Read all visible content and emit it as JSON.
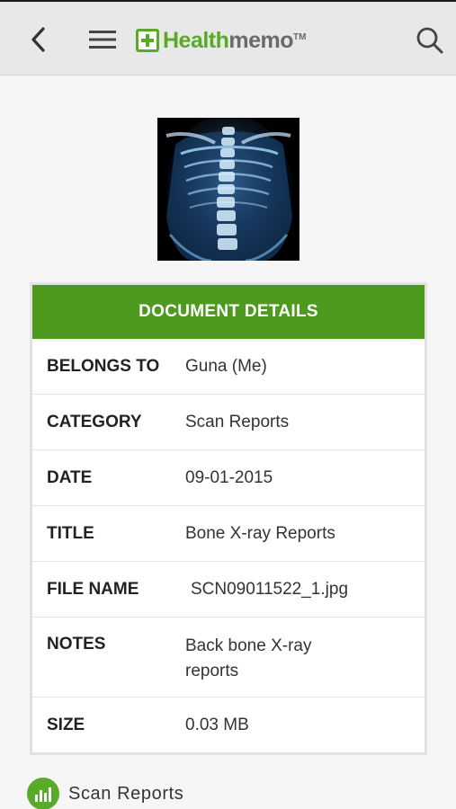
{
  "header": {
    "logo_part1": "Health",
    "logo_part2": "memo",
    "logo_tm": "TM"
  },
  "document": {
    "header_title": "DOCUMENT DETAILS",
    "rows": [
      {
        "label": "BELONGS TO",
        "value": "Guna (Me)"
      },
      {
        "label": "CATEGORY",
        "value": "Scan Reports"
      },
      {
        "label": "DATE",
        "value": "09-01-2015"
      },
      {
        "label": "TITLE",
        "value": "Bone X-ray Reports"
      },
      {
        "label": "FILE NAME",
        "value": "SCN09011522_1.jpg"
      },
      {
        "label": "NOTES",
        "value": "Back bone X-ray reports"
      },
      {
        "label": "SIZE",
        "value": "0.03 MB"
      }
    ]
  },
  "footer": {
    "link_label": "Scan Reports"
  },
  "colors": {
    "brand_green": "#5aaa2a",
    "header_green": "#4e9a1f"
  },
  "icons": [
    "back-arrow-icon",
    "hamburger-menu-icon",
    "medical-cross-icon",
    "search-icon",
    "bar-chart-icon"
  ]
}
